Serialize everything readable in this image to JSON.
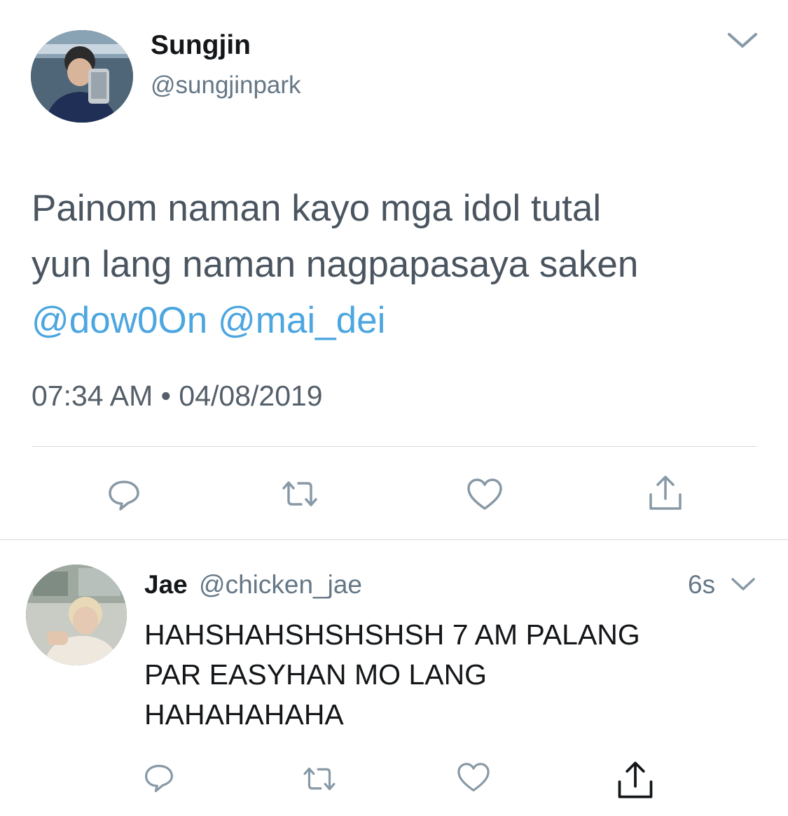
{
  "main_tweet": {
    "display_name": "Sungjin",
    "handle": "@sungjinpark",
    "text_line1": "Painom naman kayo mga idol tutal",
    "text_line2": "yun lang naman nagpapasaya saken",
    "mention1": "@dow0On",
    "mention2": "@mai_dei",
    "time": "07:34 AM",
    "separator": "•",
    "date": "04/08/2019"
  },
  "reply": {
    "display_name": "Jae",
    "handle": "@chicken_jae",
    "age": "6s",
    "text_line1": "HAHSHAHSHSHSHSH 7 AM PALANG",
    "text_line2": "PAR EASYHAN MO LANG",
    "text_line3": "HAHAHAHAHA"
  },
  "colors": {
    "link": "#4ca6e0",
    "muted": "#657786",
    "icon": "#8899a6",
    "divider": "#d6dbdf"
  },
  "icons": [
    "chevron-down-icon",
    "reply-icon",
    "retweet-icon",
    "like-icon",
    "share-icon"
  ]
}
